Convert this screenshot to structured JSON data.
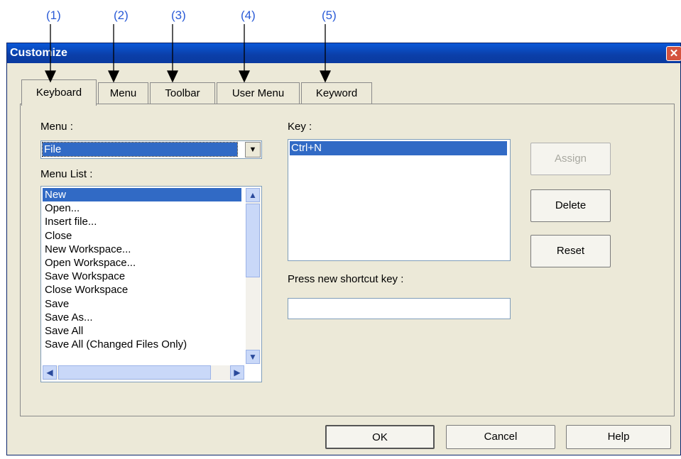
{
  "callouts": [
    "(1)",
    "(2)",
    "(3)",
    "(4)",
    "(5)"
  ],
  "window": {
    "title": "Customize",
    "close_glyph": "✕"
  },
  "tabs": [
    "Keyboard",
    "Menu",
    "Toolbar",
    "User Menu",
    "Keyword"
  ],
  "active_tab": "Keyboard",
  "menu": {
    "label": "Menu :",
    "value": "File"
  },
  "menu_list": {
    "label": "Menu List :",
    "items": [
      "New",
      "Open...",
      "Insert file...",
      "Close",
      "New Workspace...",
      "Open Workspace...",
      "Save Workspace",
      "Close Workspace",
      "Save",
      "Save As...",
      "Save All",
      "Save All (Changed Files Only)"
    ],
    "selected": "New"
  },
  "key": {
    "label": "Key :",
    "items": [
      "Ctrl+N"
    ]
  },
  "shortcut": {
    "label": "Press new shortcut key :",
    "value": ""
  },
  "side_buttons": {
    "assign": "Assign",
    "delete": "Delete",
    "reset": "Reset"
  },
  "footer_buttons": {
    "ok": "OK",
    "cancel": "Cancel",
    "help": "Help"
  },
  "colors": {
    "titlebar": "#0a3aa0",
    "selection": "#316ac5",
    "callout": "#2a5bd7",
    "dialog_bg": "#ece9d8"
  }
}
